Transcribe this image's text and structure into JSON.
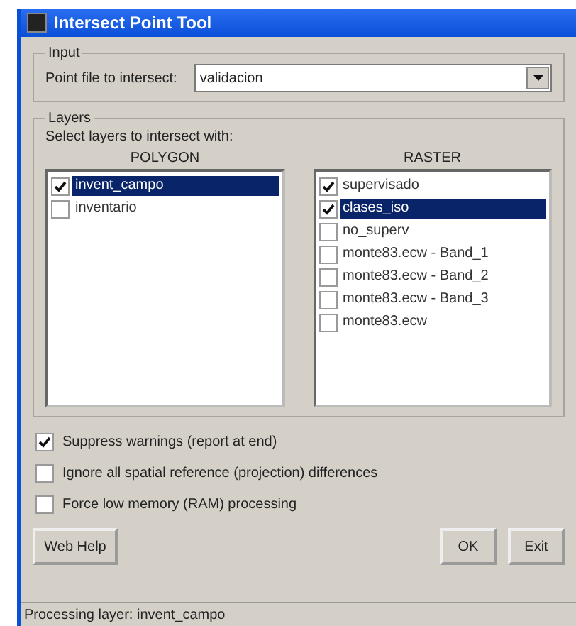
{
  "window": {
    "title": "Intersect Point Tool"
  },
  "input": {
    "legend": "Input",
    "label": "Point file to intersect:",
    "value": "validacion"
  },
  "layers": {
    "legend": "Layers",
    "prompt": "Select layers to intersect with:",
    "polygon": {
      "heading": "POLYGON",
      "items": [
        {
          "label": "invent_campo",
          "checked": true,
          "selected": true
        },
        {
          "label": "inventario",
          "checked": false,
          "selected": false
        }
      ]
    },
    "raster": {
      "heading": "RASTER",
      "items": [
        {
          "label": "supervisado",
          "checked": true,
          "selected": false
        },
        {
          "label": "clases_iso",
          "checked": true,
          "selected": true
        },
        {
          "label": "no_superv",
          "checked": false,
          "selected": false
        },
        {
          "label": "monte83.ecw - Band_1",
          "checked": false,
          "selected": false
        },
        {
          "label": "monte83.ecw - Band_2",
          "checked": false,
          "selected": false
        },
        {
          "label": "monte83.ecw - Band_3",
          "checked": false,
          "selected": false
        },
        {
          "label": "monte83.ecw",
          "checked": false,
          "selected": false
        }
      ]
    }
  },
  "options": [
    {
      "label": "Suppress warnings (report at end)",
      "checked": true
    },
    {
      "label": "Ignore all spatial reference (projection) differences",
      "checked": false
    },
    {
      "label": "Force low memory (RAM) processing",
      "checked": false
    }
  ],
  "buttons": {
    "help": "Web Help",
    "ok": "OK",
    "exit": "Exit"
  },
  "status_bar": "Processing layer: invent_campo"
}
